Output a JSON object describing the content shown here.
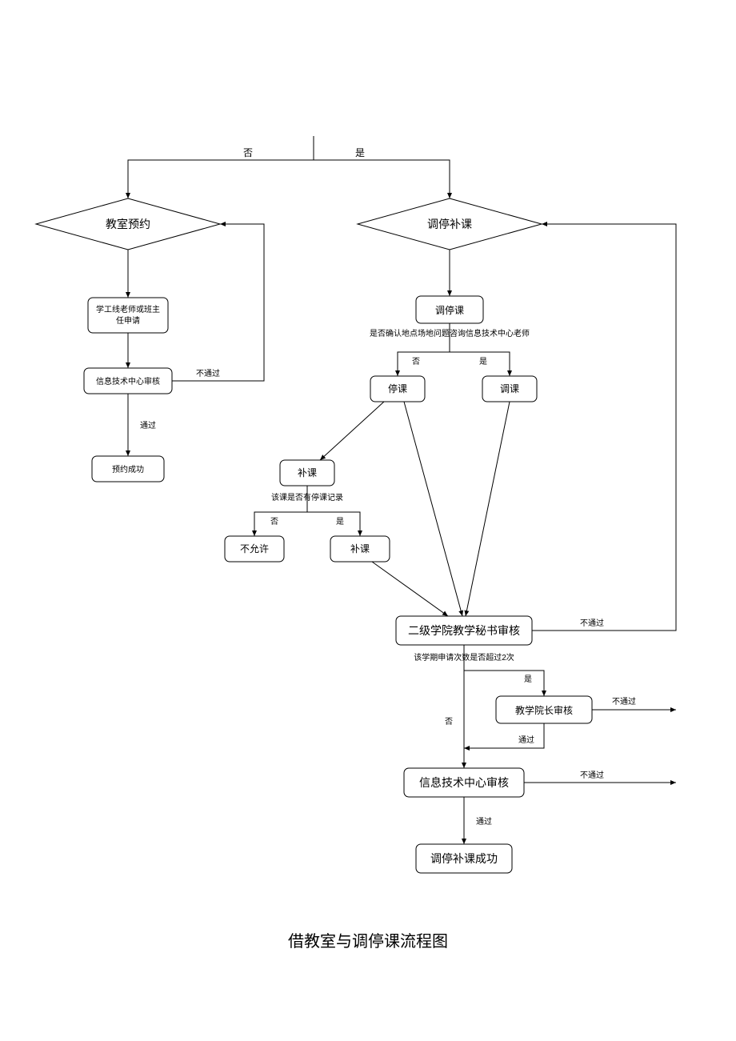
{
  "caption": "借教室与调停课流程图",
  "labels": {
    "no": "否",
    "yes": "是",
    "pass": "通过",
    "fail": "不通过"
  },
  "nodes": {
    "d_reserve": "教室预约",
    "d_adjust": "调停补课",
    "p_apply": "学工线老师或班主任申请",
    "p_itc_review": "信息技术中心审核",
    "p_reserve_ok": "预约成功",
    "p_adjust_course": "调停课",
    "q_location": "是否确认地点场地问题咨询信息技术中心老师",
    "p_stop": "停课",
    "p_change": "调课",
    "p_makeup1": "补课",
    "q_has_stop": "该课是否有停课记录",
    "p_not_allowed": "不允许",
    "p_makeup2": "补课",
    "p_secretary": "二级学院教学秘书审核",
    "q_over2": "该学期申请次数是否超过2次",
    "p_dean": "教学院长审核",
    "p_itc_review2": "信息技术中心审核",
    "p_success": "调停补课成功"
  }
}
